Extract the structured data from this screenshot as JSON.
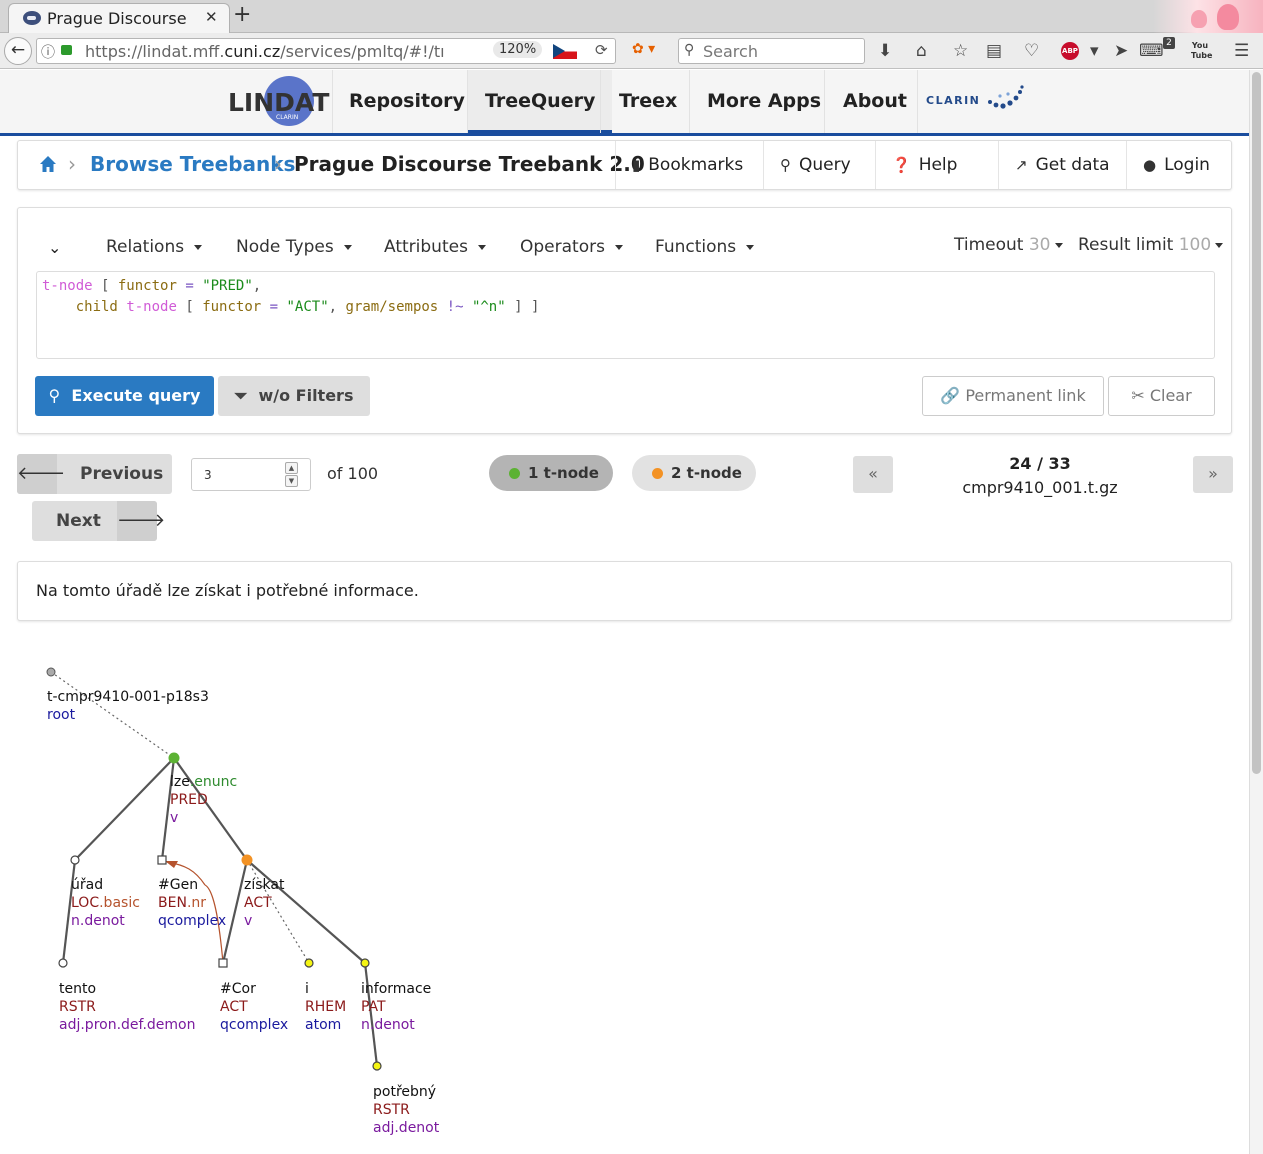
{
  "browser": {
    "tab_title": "Prague Discourse",
    "tab_close": "✕",
    "new_tab": "+",
    "url_prefix": "https://lindat.mff.",
    "url_domain": "cuni.cz",
    "url_suffix": "/services/pmltq/#!/tı",
    "zoom": "120%",
    "search_placeholder": "Search",
    "addon_badge": "2",
    "abp_label": "ABP",
    "yt_label": "You Tube"
  },
  "site": {
    "logo_text": "LINDAT",
    "logo_sub": "CLARIN",
    "nav": [
      "Repository",
      "TreeQuery",
      "Treex",
      "More Apps",
      "About"
    ],
    "active_nav": "TreeQuery",
    "clarin_logo": "CLARIN"
  },
  "breadcrumb": {
    "browse": "Browse Treebanks",
    "current": "Prague Discourse Treebank 2.0",
    "actions": [
      "Bookmarks",
      "Query",
      "Help",
      "Get data",
      "Login"
    ]
  },
  "query": {
    "menus": [
      "Relations",
      "Node Types",
      "Attributes",
      "Operators",
      "Functions"
    ],
    "timeout_label": "Timeout",
    "timeout_value": "30",
    "limit_label": "Result limit",
    "limit_value": "100",
    "code_line1": [
      {
        "t": "t-node",
        "c": "k-node"
      },
      {
        "t": " [ ",
        "c": "k-punct"
      },
      {
        "t": "functor",
        "c": "k-attr"
      },
      {
        "t": " = ",
        "c": "k-op"
      },
      {
        "t": "\"PRED\"",
        "c": "k-str"
      },
      {
        "t": ",",
        "c": "k-punct"
      }
    ],
    "code_line2": [
      {
        "t": "    ",
        "c": "k-punct"
      },
      {
        "t": "child",
        "c": "k-rel"
      },
      {
        "t": " ",
        "c": "k-punct"
      },
      {
        "t": "t-node",
        "c": "k-node"
      },
      {
        "t": " [ ",
        "c": "k-punct"
      },
      {
        "t": "functor",
        "c": "k-attr"
      },
      {
        "t": " = ",
        "c": "k-op"
      },
      {
        "t": "\"ACT\"",
        "c": "k-str"
      },
      {
        "t": ", ",
        "c": "k-punct"
      },
      {
        "t": "gram/sempos",
        "c": "k-attr"
      },
      {
        "t": " !~ ",
        "c": "k-op"
      },
      {
        "t": "\"^n\"",
        "c": "k-str"
      },
      {
        "t": " ] ]",
        "c": "k-punct"
      }
    ],
    "execute": "Execute query",
    "no_filters": "w/o Filters",
    "permalink": "Permanent link",
    "clear": "Clear"
  },
  "pager": {
    "previous": "Previous",
    "next": "Next",
    "page": "3",
    "of": "of 100",
    "node1_label": "1  t-node",
    "node2_label": "2  t-node",
    "node1_color": "#5cb233",
    "node2_color": "#f39224",
    "tree_counter": "24 / 33",
    "tree_file": "cmpr9410_001.t.gz",
    "prev_tree": "«",
    "next_tree": "»"
  },
  "sentence": "Na tomto úřadě lze získat i potřebné informace.",
  "tree": {
    "root": {
      "id": "t-cmpr9410-001-p18s3",
      "label": "root"
    },
    "lze": {
      "lemma": "lze",
      "suffix": ".enunc",
      "functor": "PRED",
      "sempos": "v"
    },
    "urad": {
      "lemma": "úřad",
      "functor": "LOC",
      "subfunctor": ".basic",
      "sempos": "n.denot"
    },
    "gen": {
      "lemma": "#Gen",
      "functor": "BEN",
      "subfunctor": ".nr",
      "sempos": "qcomplex"
    },
    "ziskat": {
      "lemma": "získat",
      "functor": "ACT",
      "sempos": "v"
    },
    "tento": {
      "lemma": "tento",
      "functor": "RSTR",
      "sempos": "adj.pron.def.demon"
    },
    "cor": {
      "lemma": "#Cor",
      "functor": "ACT",
      "sempos": "qcomplex"
    },
    "i": {
      "lemma": "i",
      "functor": "RHEM",
      "sempos": "atom"
    },
    "informace": {
      "lemma": "informace",
      "functor": "PAT",
      "sempos": "n.denot"
    },
    "potrebny": {
      "lemma": "potřebný",
      "functor": "RSTR",
      "sempos": "adj.denot"
    }
  }
}
